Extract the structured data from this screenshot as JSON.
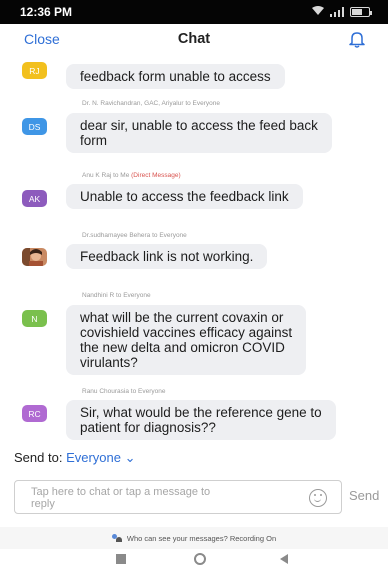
{
  "status_bar": {
    "time": "12:36 PM"
  },
  "header": {
    "close_label": "Close",
    "title": "Chat",
    "right_icon": "bell-icon"
  },
  "messages": [
    {
      "meta": "",
      "avatar_initials": "RJ",
      "avatar_color": "#f2c01e",
      "text_lines": [
        "feedback form unable to access"
      ]
    },
    {
      "meta": "Dr. N. Ravichandran, GAC, Ariyalur to Everyone",
      "avatar_initials": "DS",
      "avatar_color": "#3f96e6",
      "text_lines": [
        "dear sir, unable to access the feed back",
        "form"
      ]
    },
    {
      "meta": "Anu K Raj to Me",
      "meta_tag": "(Direct Message)",
      "avatar_initials": "AK",
      "avatar_color": "#8d5bbd",
      "text_lines": [
        "Unable to access the feedback link"
      ]
    },
    {
      "meta": "Dr.sudhamayee Behera to Everyone",
      "avatar_initials": "",
      "avatar_icon": "profile-photo",
      "text_lines": [
        "Feedback link is not working."
      ]
    },
    {
      "meta": "Nandhini R to Everyone",
      "avatar_initials": "N",
      "avatar_color": "#7ac04d",
      "text_lines": [
        "what will be the current covaxin or",
        "covishield vaccines efficacy against",
        "the new delta and omicron COVID",
        "virulants?"
      ]
    },
    {
      "meta": "Ranu Chourasia to Everyone",
      "avatar_initials": "RC",
      "avatar_color": "#b06ad2",
      "text_lines": [
        "Sir, what would be the reference gene to",
        "patient for diagnosis??"
      ]
    }
  ],
  "send_to": {
    "label": "Send to:",
    "target": "Everyone"
  },
  "input": {
    "placeholder_lines": [
      "Tap here to chat or tap a message to",
      "reply"
    ],
    "send_label": "Send"
  },
  "privacy": {
    "text": "Who can see your messages? Recording On"
  }
}
